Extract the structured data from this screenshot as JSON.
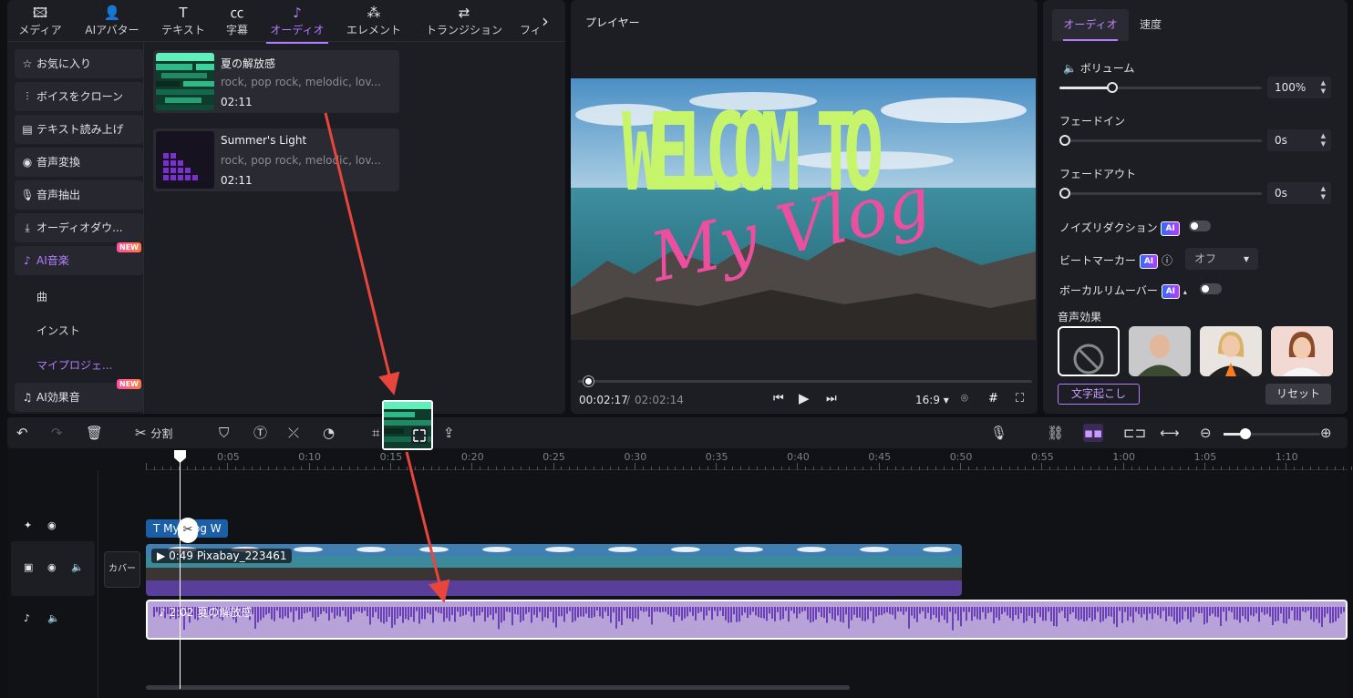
{
  "nav": {
    "items": [
      {
        "label": "メディア",
        "icon": "media-icon"
      },
      {
        "label": "AIアバター",
        "icon": "avatar-icon"
      },
      {
        "label": "テキスト",
        "icon": "text-icon"
      },
      {
        "label": "字幕",
        "icon": "caption-icon"
      },
      {
        "label": "オーディオ",
        "icon": "music-note-icon"
      },
      {
        "label": "エレメント",
        "icon": "elements-icon"
      },
      {
        "label": "トランジション",
        "icon": "transition-icon"
      },
      {
        "label": "フィ",
        "icon": ""
      }
    ],
    "active_index": 4
  },
  "sidebar": {
    "items": [
      {
        "label": "お気に入り",
        "icon": "star-icon"
      },
      {
        "label": "ボイスをクローン",
        "icon": "waveform-icon"
      },
      {
        "label": "テキスト読み上げ",
        "icon": "document-icon"
      },
      {
        "label": "音声変換",
        "icon": "voice-change-icon"
      },
      {
        "label": "音声抽出",
        "icon": "microphone-icon"
      },
      {
        "label": "オーディオダウ...",
        "icon": "download-icon"
      },
      {
        "label": "AI音楽",
        "icon": "ai-music-icon",
        "badge": "NEW"
      },
      {
        "label": "AI効果音",
        "icon": "ai-sfx-icon",
        "badge": "NEW"
      }
    ],
    "sub_items": [
      "曲",
      "インスト",
      "マイプロジェ..."
    ]
  },
  "library": {
    "items": [
      {
        "title": "夏の解放感",
        "tags": "rock, pop rock, melodic, lov...",
        "duration": "02:11"
      },
      {
        "title": "Summer's Light",
        "tags": "rock, pop rock, melodic, lov...",
        "duration": "02:11"
      }
    ]
  },
  "player": {
    "title": "プレイヤー",
    "time_current": "00:02:17",
    "time_sep": "/",
    "time_total": "02:02:14",
    "aspect_ratio": "16:9",
    "progress_fraction": 0.02,
    "overlay_line1": "WELCOM TO",
    "overlay_line2": "My Vlog"
  },
  "audio_panel": {
    "tab_audio": "オーディオ",
    "tab_speed": "速度",
    "volume_label": "ボリューム",
    "volume_value": "100%",
    "volume_fraction": 0.26,
    "fadein_label": "フェードイン",
    "fadein_value": "0s",
    "fadeout_label": "フェードアウト",
    "fadeout_value": "0s",
    "noise_label": "ノイズリダクション",
    "beat_label": "ビートマーカー",
    "beat_value": "オフ",
    "vocal_label": "ボーカルリムーバー",
    "ai_badge": "AI",
    "effects_label": "音声効果",
    "transcribe_button": "文字起こし",
    "reset_button": "リセット"
  },
  "toolbar": {
    "split_label": "分割"
  },
  "timeline": {
    "ruler_labels": [
      "0:05",
      "0:10",
      "0:15",
      "0:20",
      "0:25",
      "0:30",
      "0:35",
      "0:40",
      "0:45",
      "0:50",
      "0:55",
      "1:00",
      "1:05",
      "1:10"
    ],
    "text_clip_label": "My Vlog W",
    "video_clip_label": "0:49 Pixabay_223461",
    "audio_clip_label": "2:02 夏の解放感",
    "cover_label": "カバー"
  },
  "colors": {
    "accent": "#b47cff",
    "panel": "#1d1e24",
    "background": "#0f1014",
    "overlay_green": "#c6f56b",
    "overlay_pink": "#ec4f9e",
    "annotation_red": "#e8453c"
  }
}
